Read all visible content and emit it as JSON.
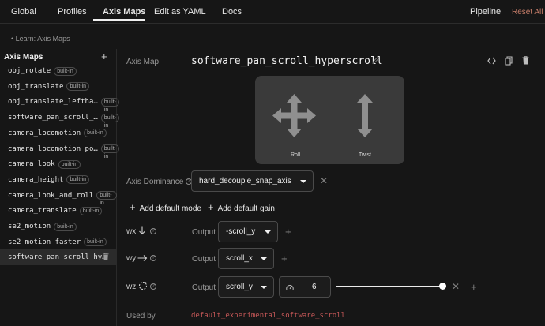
{
  "nav": {
    "tabs": [
      "Global",
      "Profiles",
      "Axis Maps",
      "Edit as YAML",
      "Docs"
    ],
    "pipeline": "Pipeline",
    "reset_all": "Reset All"
  },
  "learn_link": "• Learn: Axis Maps",
  "sidebar": {
    "title": "Axis Maps",
    "add": "+",
    "badge": "built-in",
    "items": [
      {
        "name": "obj_rotate",
        "builtin": true
      },
      {
        "name": "obj_translate",
        "builtin": true
      },
      {
        "name": "obj_translate_leftha…",
        "builtin": true
      },
      {
        "name": "software_pan_scroll_…",
        "builtin": true
      },
      {
        "name": "camera_locomotion",
        "builtin": true
      },
      {
        "name": "camera_locomotion_po…",
        "builtin": true
      },
      {
        "name": "camera_look",
        "builtin": true
      },
      {
        "name": "camera_height",
        "builtin": true
      },
      {
        "name": "camera_look_and_roll",
        "builtin": true
      },
      {
        "name": "camera_translate",
        "builtin": true
      },
      {
        "name": "se2_motion",
        "builtin": true
      },
      {
        "name": "se2_motion_faster",
        "builtin": true
      },
      {
        "name": "software_pan_scroll_hy…",
        "builtin": false,
        "selected": true
      }
    ]
  },
  "editor": {
    "axis_map_label": "Axis Map",
    "title": "software_pan_scroll_hyperscroll",
    "preview": {
      "roll": "Roll",
      "twist": "Twist"
    },
    "dominance_label": "Axis Dominance",
    "dominance_value": "hard_decouple_snap_axis",
    "add_default_mode": "Add default mode",
    "add_default_gain": "Add default gain",
    "output_label": "Output",
    "axes": [
      {
        "name": "wx",
        "output": "-scroll_y"
      },
      {
        "name": "wy",
        "output": "scroll_x"
      },
      {
        "name": "wz",
        "output": "scroll_y",
        "gain": "6",
        "gain_fraction": 1.0
      }
    ],
    "used_by_label": "Used by",
    "used_by_value": "default_experimental_software_scroll"
  },
  "colors": {
    "accent_danger": "#c75858",
    "background": "#161616",
    "panel": "#3a3a3a"
  }
}
